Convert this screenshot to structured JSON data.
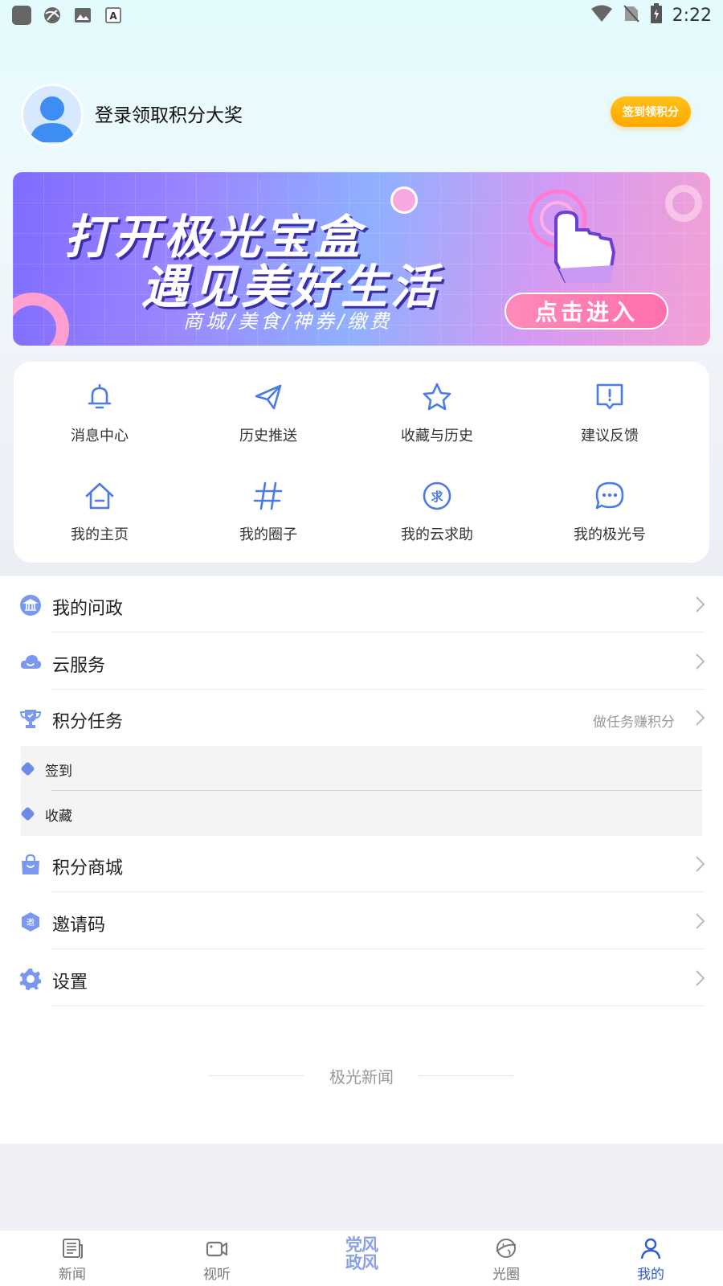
{
  "status_bar": {
    "time": "2:22",
    "left_icons": [
      "app-square-icon",
      "globe-icon",
      "image-icon",
      "font-icon"
    ],
    "right_icons": [
      "wifi-icon",
      "no-sim-icon",
      "battery-charging-icon"
    ]
  },
  "user": {
    "login_prompt": "登录领取积分大奖",
    "checkin_label": "签到领积分"
  },
  "banner": {
    "line1": "打开极光宝盒",
    "line2": "遇见美好生活",
    "subtitle": "商城/美食/神券/缴费",
    "cta": "点击进入"
  },
  "grid": [
    {
      "label": "消息中心",
      "icon": "bell-icon"
    },
    {
      "label": "历史推送",
      "icon": "paper-plane-icon"
    },
    {
      "label": "收藏与历史",
      "icon": "star-icon"
    },
    {
      "label": "建议反馈",
      "icon": "feedback-icon"
    },
    {
      "label": "我的主页",
      "icon": "home-icon"
    },
    {
      "label": "我的圈子",
      "icon": "hash-icon"
    },
    {
      "label": "我的云求助",
      "icon": "help-request-icon"
    },
    {
      "label": "我的极光号",
      "icon": "chat-bubble-icon"
    }
  ],
  "menu": [
    {
      "label": "我的问政",
      "icon": "government-icon",
      "hint": ""
    },
    {
      "label": "云服务",
      "icon": "cloud-icon",
      "hint": ""
    },
    {
      "label": "积分任务",
      "icon": "trophy-icon",
      "hint": "做任务赚积分"
    },
    {
      "label": "积分商城",
      "icon": "shopping-bag-icon",
      "hint": ""
    },
    {
      "label": "邀请码",
      "icon": "invite-code-icon",
      "hint": ""
    },
    {
      "label": "设置",
      "icon": "gear-icon",
      "hint": ""
    }
  ],
  "task_sub_items": [
    "签到",
    "收藏"
  ],
  "footer_brand": "极光新闻",
  "bottom_nav": {
    "items": [
      {
        "label": "新闻",
        "icon": "newspaper-icon"
      },
      {
        "label": "视听",
        "icon": "video-icon"
      },
      {
        "label": "光圈",
        "icon": "planet-icon"
      },
      {
        "label": "我的",
        "icon": "person-icon"
      }
    ],
    "center_line1": "党风",
    "center_line2": "政风",
    "active": "我的"
  },
  "colors": {
    "accent_blue": "#4a7be8",
    "checkin_orange": "#ffae00",
    "active_nav": "#2f5bd8"
  }
}
